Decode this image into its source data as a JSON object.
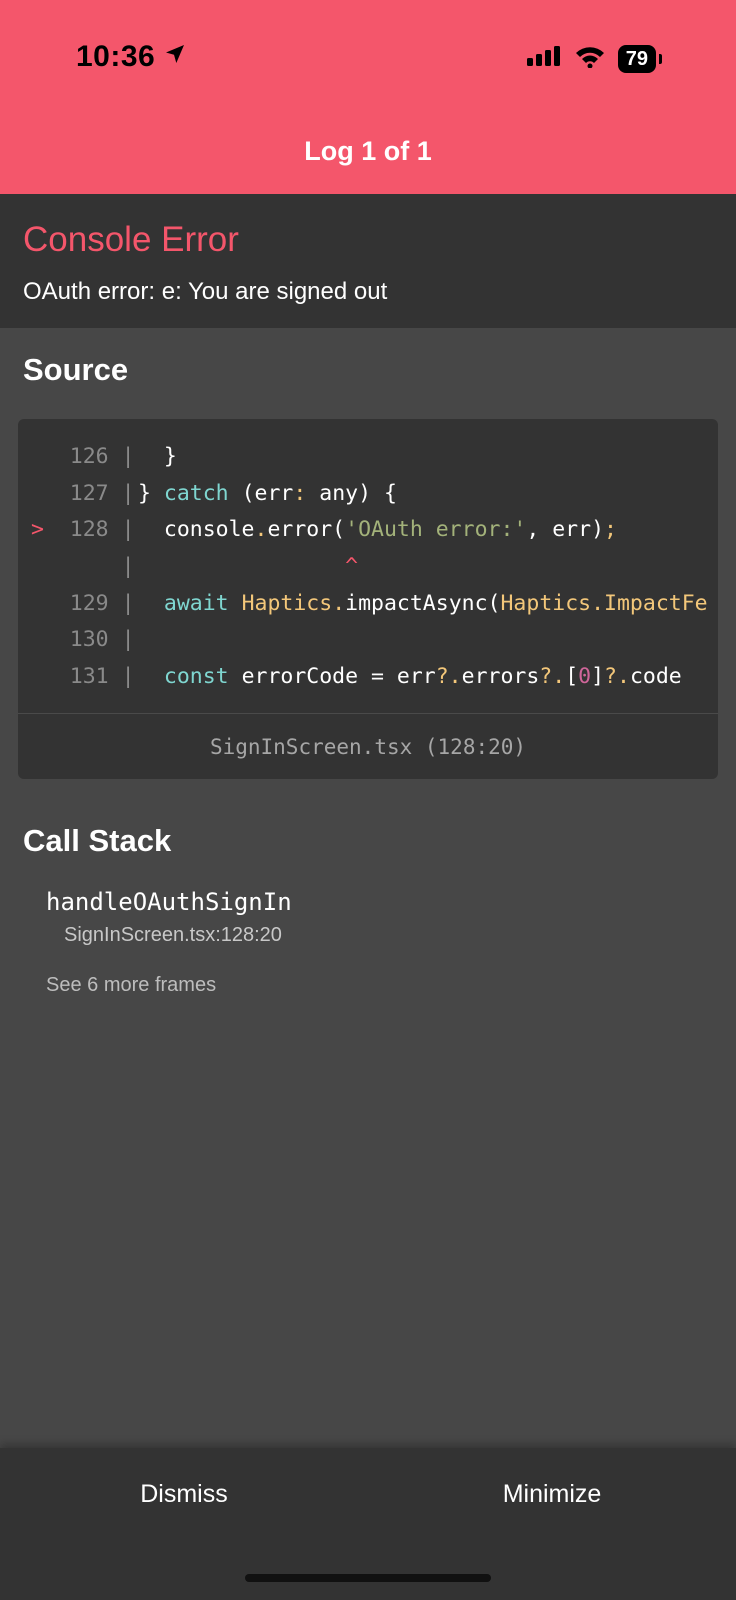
{
  "status_bar": {
    "time": "10:36",
    "battery": "79"
  },
  "header": {
    "title": "Log 1 of 1",
    "accent_color": "#f4566b"
  },
  "error": {
    "title": "Console Error",
    "message": "OAuth error: e: You are signed out"
  },
  "source": {
    "section_title": "Source",
    "lines": [
      {
        "marker": "",
        "number": "126",
        "sep": "|",
        "tokens": [
          {
            "t": "  }",
            "c": "plain"
          }
        ]
      },
      {
        "marker": "",
        "number": "127",
        "sep": "|",
        "tokens": [
          {
            "t": "} ",
            "c": "plain"
          },
          {
            "t": "catch",
            "c": "kw"
          },
          {
            "t": " (err",
            "c": "plain"
          },
          {
            "t": ":",
            "c": "obj"
          },
          {
            "t": " any) {",
            "c": "plain"
          }
        ]
      },
      {
        "marker": ">",
        "number": "128",
        "sep": "|",
        "tokens": [
          {
            "t": "  console",
            "c": "plain"
          },
          {
            "t": ".",
            "c": "obj"
          },
          {
            "t": "error(",
            "c": "plain"
          },
          {
            "t": "'OAuth error:'",
            "c": "str"
          },
          {
            "t": ", err)",
            "c": "plain"
          },
          {
            "t": ";",
            "c": "obj"
          }
        ]
      },
      {
        "marker": "",
        "number": "",
        "sep": "|",
        "tokens": [
          {
            "t": "                ^",
            "c": "caret"
          }
        ]
      },
      {
        "marker": "",
        "number": "129",
        "sep": "|",
        "tokens": [
          {
            "t": "  ",
            "c": "plain"
          },
          {
            "t": "await",
            "c": "kw"
          },
          {
            "t": " ",
            "c": "plain"
          },
          {
            "t": "Haptics",
            "c": "obj"
          },
          {
            "t": ".",
            "c": "obj"
          },
          {
            "t": "impactAsync(",
            "c": "plain"
          },
          {
            "t": "Haptics",
            "c": "obj"
          },
          {
            "t": ".",
            "c": "obj"
          },
          {
            "t": "ImpactFe",
            "c": "obj"
          }
        ]
      },
      {
        "marker": "",
        "number": "130",
        "sep": "|",
        "tokens": []
      },
      {
        "marker": "",
        "number": "131",
        "sep": "|",
        "tokens": [
          {
            "t": "  ",
            "c": "plain"
          },
          {
            "t": "const",
            "c": "kw"
          },
          {
            "t": " errorCode = err",
            "c": "plain"
          },
          {
            "t": "?.",
            "c": "obj"
          },
          {
            "t": "errors",
            "c": "plain"
          },
          {
            "t": "?.",
            "c": "obj"
          },
          {
            "t": "[",
            "c": "plain"
          },
          {
            "t": "0",
            "c": "num"
          },
          {
            "t": "]",
            "c": "plain"
          },
          {
            "t": "?.",
            "c": "obj"
          },
          {
            "t": "code",
            "c": "plain"
          }
        ]
      }
    ],
    "file_location": "SignInScreen.tsx (128:20)"
  },
  "call_stack": {
    "section_title": "Call Stack",
    "frames": [
      {
        "function": "handleOAuthSignIn",
        "location": "SignInScreen.tsx:128:20"
      }
    ],
    "more_frames_label": "See 6 more frames"
  },
  "footer": {
    "dismiss_label": "Dismiss",
    "minimize_label": "Minimize"
  }
}
